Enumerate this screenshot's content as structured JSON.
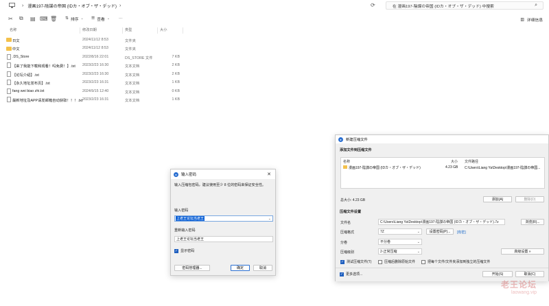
{
  "explorer": {
    "path": "漫画197-陰謀の帝国 (IDカ・オブ・ザ・デッド)",
    "search_placeholder": "在 漫画197-陰謀の帝国 (IDカ・オブ・ザ・デッド) 中搜索",
    "toolbar": {
      "sort_label": "排序",
      "view_label": "查看",
      "more_label": "···",
      "details_label": "详细信息"
    },
    "columns": {
      "name": "名称",
      "date": "修改日期",
      "type": "类型",
      "size": "大小"
    },
    "files": [
      {
        "icon": "folder-icon",
        "name": "日文",
        "date": "2024/11/12 8:53",
        "type": "文件夹",
        "size": ""
      },
      {
        "icon": "folder-icon",
        "name": "中文",
        "date": "2024/11/12 8:53",
        "type": "文件夹",
        "size": ""
      },
      {
        "icon": "file-icon",
        "name": ".DS_Store",
        "date": "2022/8/16 22:01",
        "type": "DS_STORE 文件",
        "size": "7 KB"
      },
      {
        "icon": "text-file-icon",
        "name": "【来了我能下载和观看！吗免费！】.txt",
        "date": "2023/2/23 16:30",
        "type": "文本文档",
        "size": "2 KB"
      },
      {
        "icon": "text-file-icon",
        "name": "【论坛介绍】.txt",
        "date": "2023/2/23 16:30",
        "type": "文本文档",
        "size": "2 KB"
      },
      {
        "icon": "text-file-icon",
        "name": "【永久地址发布页】.txt",
        "date": "2023/2/23 16:31",
        "type": "文本文档",
        "size": "1 KB"
      },
      {
        "icon": "text-file-icon",
        "name": "fang wei biao zhi.txt",
        "date": "2024/9/15 12:40",
        "type": "文本文档",
        "size": "0 KB"
      },
      {
        "icon": "text-file-icon",
        "name": "最新地址及APP请发邮箱自动获取！！！.txt",
        "date": "2023/2/23 16:31",
        "type": "文本文档",
        "size": "1 KB"
      }
    ]
  },
  "password_dialog": {
    "title": "输入密码",
    "note": "输入压缩包密码，建议使用至少 8 位的密码来保证安全性。",
    "label_password": "输入密码",
    "password_value": "上老王论坛当老王",
    "label_reenter": "重新输入密码",
    "reenter_value": "上老王论坛当老王",
    "show_password_label": "显示密码",
    "manager_button": "密码管理器...",
    "ok_button": "确定",
    "cancel_button": "取消"
  },
  "compress_dialog": {
    "title": "新建压缩文件",
    "section_add": "添加文件到压缩文件",
    "col_name": "名称",
    "col_size": "大小",
    "col_path": "文件路径",
    "item_name": "漫画197-陰謀の帝国 (IDカ・オブ・ザ・デッド)",
    "item_size": "4.23 GB",
    "item_path": "C:\\Users\\Liang Ya\\Desktop\\漫画197-陰謀の帝国...",
    "total_label": "总大小: 4.23 GB",
    "add_button": "添加(A)",
    "delete_button": "删除(D)",
    "section_settings": "压缩文件设置",
    "file_name_label": "文件名",
    "file_name_value": "C:\\Users\\Liang Ya\\Desktop\\漫画197-陰謀の帝国 (IDカ・オブ・ザ・デッド).7z",
    "browse_button": "浏览(R)...",
    "format_label": "压缩格式",
    "format_value": "7Z",
    "set_password_button": "设置密码(P)...",
    "encrypted_tag": "[有密]",
    "split_label": "分卷",
    "split_value": "不分卷",
    "level_label": "压缩级别",
    "level_value": "2-正常压缩",
    "advanced_button": "高级设置 »",
    "test_label": "测试压缩文件(T)",
    "delete_after_label": "压缩后删除原始文件",
    "each_file_label": "把每个文件/文件夹添加到独立的压缩文件",
    "more_options": "更多选项...",
    "start_button": "开始(S)",
    "cancel_button": "取消(C)"
  },
  "watermark": {
    "line1": "老王论坛",
    "line2": "laowang.vip"
  }
}
